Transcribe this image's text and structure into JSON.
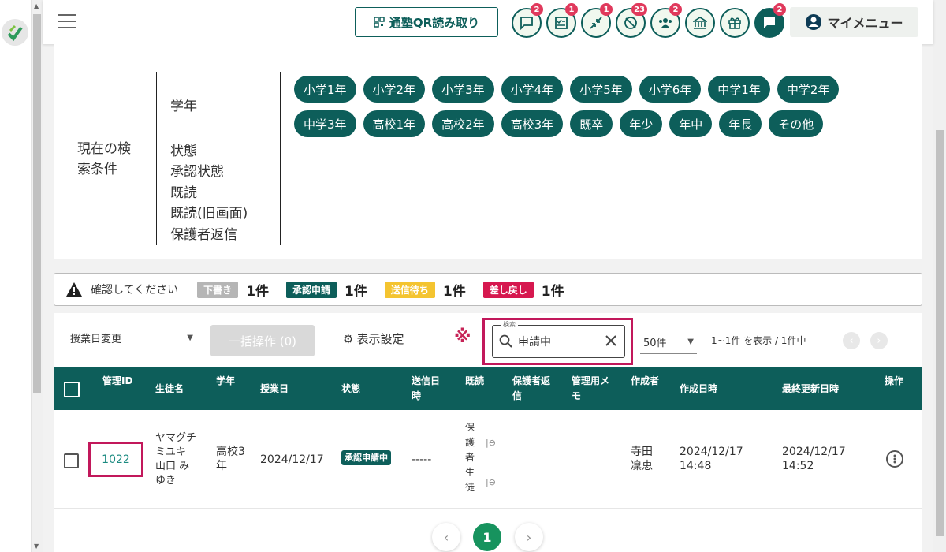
{
  "header": {
    "qr_button": "通塾QR読み取り",
    "icons": [
      {
        "name": "message-icon",
        "badge": "2"
      },
      {
        "name": "checklist-icon",
        "badge": "1"
      },
      {
        "name": "compress-arrows-icon",
        "badge": "1"
      },
      {
        "name": "no-location-icon",
        "badge": "23"
      },
      {
        "name": "group-icon",
        "badge": "2"
      },
      {
        "name": "bank-icon",
        "badge": ""
      },
      {
        "name": "gift-icon",
        "badge": ""
      },
      {
        "name": "chat-icon",
        "badge": "2"
      }
    ],
    "my_menu": "マイメニュー"
  },
  "conditions": {
    "title": "現在の検索条件",
    "labels": [
      "学年",
      "状態",
      "承認状態",
      "既読",
      "既読(旧画面)",
      "保護者返信"
    ],
    "grade_chips": [
      "小学1年",
      "小学2年",
      "小学3年",
      "小学4年",
      "小学5年",
      "小学6年",
      "中学1年",
      "中学2年",
      "中学3年",
      "高校1年",
      "高校2年",
      "高校3年",
      "既卒",
      "年少",
      "年中",
      "年長",
      "その他"
    ]
  },
  "banner": {
    "message": "確認してください",
    "items": [
      {
        "tag": "下書き",
        "count": "1件",
        "color": "#b5b5b5"
      },
      {
        "tag": "承認申請",
        "count": "1件",
        "color": "#0d5e5a"
      },
      {
        "tag": "送信待ち",
        "count": "1件",
        "color": "#f4c430"
      },
      {
        "tag": "差し戻し",
        "count": "1件",
        "color": "#d6184f"
      }
    ]
  },
  "toolbar": {
    "date_select": "授業日変更",
    "bulk_button": "一括操作 (0)",
    "display_settings": "表示設定",
    "mark": "※",
    "search_legend": "検索",
    "search_value": "申請中",
    "per_page": "50件",
    "range_text": "1~1件 を表示 / 1件中"
  },
  "table": {
    "headers": {
      "id": "管理ID",
      "student": "生徒名",
      "grade": "学年",
      "lesson_date": "授業日",
      "status": "状態",
      "sent_at_1": "送信日",
      "sent_at_2": "時",
      "read": "既読",
      "parent_reply_1": "保護者返",
      "parent_reply_2": "信",
      "memo_1": "管理用メ",
      "memo_2": "モ",
      "creator": "作成者",
      "created_at": "作成日時",
      "updated_at": "最終更新日時",
      "actions": "操作"
    },
    "rows": [
      {
        "id": "1022",
        "student_kana": [
          "ヤマグチ",
          "ミユキ"
        ],
        "student_name": [
          "山口 み",
          "ゆき"
        ],
        "grade": [
          "高校3",
          "年"
        ],
        "lesson_date": "2024/12/17",
        "status": "承認申請中",
        "sent_at": "-----",
        "read_labels": [
          "保",
          "護",
          "者",
          "生",
          "徒"
        ],
        "creator": [
          "寺田",
          "凜恵"
        ],
        "created_at": [
          "2024/12/17",
          "14:48"
        ],
        "updated_at": [
          "2024/12/17",
          "14:52"
        ]
      }
    ]
  },
  "pagination": {
    "current": "1"
  },
  "colors": {
    "primary": "#0d5e5a",
    "highlight": "#c2185b",
    "link": "#1a8a80"
  }
}
